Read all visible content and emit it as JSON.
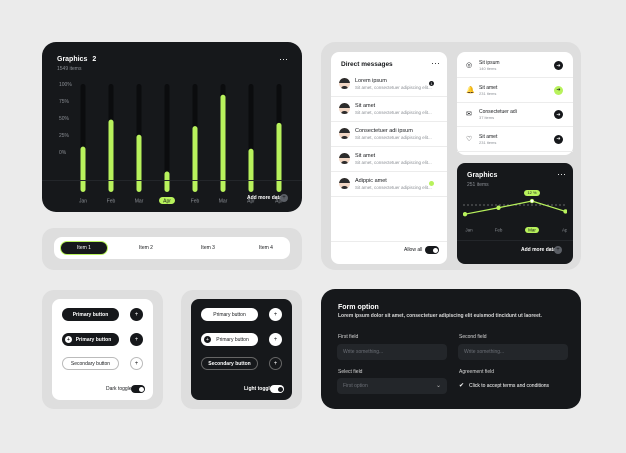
{
  "colors": {
    "accent": "#b8f25c",
    "dark": "#16181b",
    "card": "#ffffff",
    "panel": "#dedede"
  },
  "graphics_main": {
    "title": "Graphics",
    "badge": "2",
    "subtitle": "1549 items",
    "more_icon": "more-dots-icon",
    "add_more": "Add more data",
    "ylabels": [
      "100%",
      "75%",
      "50%",
      "25%",
      "0%"
    ]
  },
  "chart_data": [
    {
      "type": "bar",
      "categories": [
        "Jan",
        "Feb",
        "Mar",
        "Apr",
        "Feb",
        "Mar",
        "Apr",
        "Apr",
        "Apr"
      ],
      "values": [
        42,
        67,
        53,
        19,
        61,
        90,
        40,
        64
      ],
      "highlight_category_index": 3,
      "ylim": [
        0,
        100
      ]
    },
    {
      "type": "line",
      "categories": [
        "Jan",
        "Feb",
        "Mar",
        "Apr"
      ],
      "values": [
        35,
        58,
        82,
        45
      ],
      "highlight_label": "12 %",
      "highlight_category_index": 2
    }
  ],
  "tabs": [
    "Item 1",
    "Item 2",
    "Item 3",
    "Item 4"
  ],
  "messages": {
    "title": "Direct messages",
    "items": [
      {
        "name": "Lorem ipsum",
        "preview": "Sit amet, consectetuer adipiscing elit...",
        "badge": "1"
      },
      {
        "name": "Sit amet",
        "preview": "Sit amet, consectetuer adipiscing elit..."
      },
      {
        "name": "Consectetuer adi ipsum",
        "preview": "Sit amet, consectetuer adipiscing elit..."
      },
      {
        "name": "Sit amet",
        "preview": "Sit amet, consectetuer adipiscing elit..."
      },
      {
        "name": "Adippic amet",
        "preview": "Sit amet, consectetuer adipiscing elit...",
        "badge": ""
      }
    ],
    "allow_all": "Allow all"
  },
  "stats": [
    {
      "title": "Sit ipsum",
      "count": "140 items",
      "icon": "globe-icon"
    },
    {
      "title": "Sit amet",
      "count": "231 items",
      "icon": "bell-icon"
    },
    {
      "title": "Consectetuer adi",
      "count": "37 items",
      "icon": "mail-icon"
    },
    {
      "title": "Sit amet",
      "count": "231 items",
      "icon": "heart-icon"
    }
  ],
  "graphics_small": {
    "title": "Graphics",
    "subtitle": "251 items",
    "add_more": "Add more data",
    "labels": [
      "Jan",
      "Feb",
      "Mar",
      "Apr"
    ]
  },
  "buttons_light": {
    "primary1": "Primary button",
    "primary2": "Primary button",
    "secondary": "Secondary button",
    "toggle_label": "Dark toggle"
  },
  "buttons_dark": {
    "primary1": "Primary button",
    "primary2": "Primary button",
    "secondary": "Secondary button",
    "toggle_label": "Light toggle"
  },
  "form": {
    "title": "Form option",
    "subtitle": "Lorem ipsum dolor sit amet, consectetuer adipiscing elit euismod tincidunt ut laoreet.",
    "first_label": "First field",
    "first_placeholder": "Write something...",
    "second_label": "Second field",
    "second_placeholder": "Write something...",
    "select_label": "Select field",
    "select_value": "First option",
    "agreement_label": "Agreement field",
    "agreement_text": "Click to accept terms and conditions"
  }
}
